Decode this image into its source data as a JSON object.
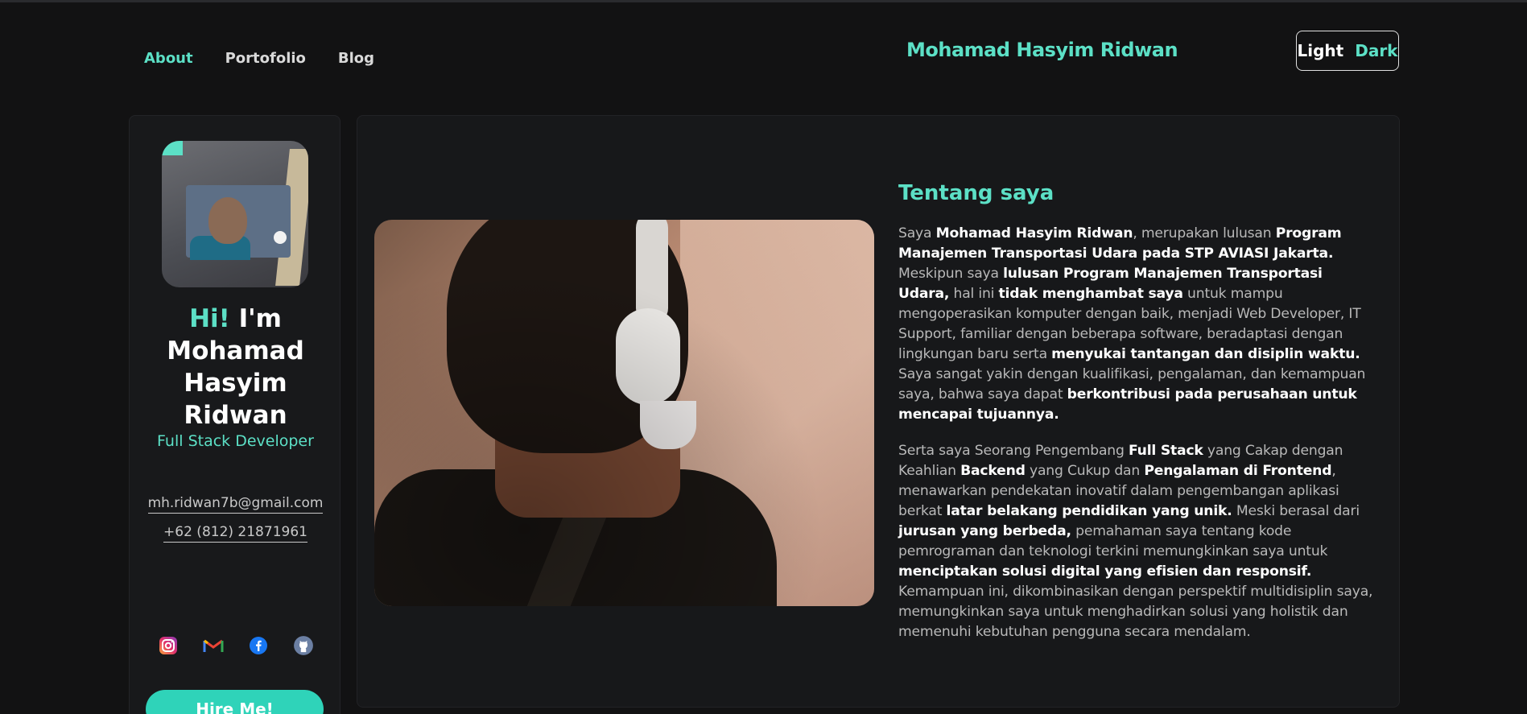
{
  "nav": {
    "items": [
      "About",
      "Portofolio",
      "Blog"
    ],
    "active": "About"
  },
  "brand": "Mohamad Hasyim Ridwan",
  "theme": {
    "light": "Light",
    "dark": "Dark"
  },
  "profile": {
    "hi": "Hi!",
    "im": "I'm",
    "name_lines": [
      "Mohamad",
      "Hasyim",
      "Ridwan"
    ],
    "role": "Full Stack Developer",
    "email": "mh.ridwan7b@gmail.com",
    "phone": "+62 (812) 21871961",
    "socials": [
      "instagram-icon",
      "gmail-icon",
      "facebook-icon",
      "github-icon"
    ],
    "hire_label": "Hire Me!"
  },
  "about": {
    "title": "Tentang saya",
    "p1": [
      {
        "t": "Saya ",
        "b": false
      },
      {
        "t": "Mohamad Hasyim Ridwan",
        "b": true
      },
      {
        "t": ", merupakan lulusan ",
        "b": false
      },
      {
        "t": "Program Manajemen Transportasi Udara pada STP AVIASI Jakarta.",
        "b": true
      },
      {
        "t": " Meskipun saya ",
        "b": false
      },
      {
        "t": "lulusan Program Manajemen Transportasi Udara,",
        "b": true
      },
      {
        "t": " hal ini ",
        "b": false
      },
      {
        "t": "tidak menghambat saya",
        "b": true
      },
      {
        "t": " untuk mampu mengoperasikan komputer dengan baik, menjadi Web Developer, IT Support, familiar dengan beberapa software, beradaptasi dengan lingkungan baru serta ",
        "b": false
      },
      {
        "t": "menyukai tantangan dan disiplin waktu.",
        "b": true
      },
      {
        "t": " Saya sangat yakin dengan kualifikasi, pengalaman, dan kemampuan saya, bahwa saya dapat ",
        "b": false
      },
      {
        "t": "berkontribusi pada perusahaan untuk mencapai tujuannya.",
        "b": true
      }
    ],
    "p2": [
      {
        "t": "Serta saya Seorang Pengembang ",
        "b": false
      },
      {
        "t": "Full Stack",
        "b": true
      },
      {
        "t": " yang Cakap dengan Keahlian ",
        "b": false
      },
      {
        "t": "Backend",
        "b": true
      },
      {
        "t": " yang Cukup dan ",
        "b": false
      },
      {
        "t": "Pengalaman di Frontend",
        "b": true
      },
      {
        "t": ", menawarkan pendekatan inovatif dalam pengembangan aplikasi berkat ",
        "b": false
      },
      {
        "t": "latar belakang pendidikan yang unik.",
        "b": true
      },
      {
        "t": " Meski berasal dari ",
        "b": false
      },
      {
        "t": "jurusan yang berbeda,",
        "b": true
      },
      {
        "t": " pemahaman saya tentang kode pemrograman dan teknologi terkini memungkinkan saya untuk ",
        "b": false
      },
      {
        "t": "menciptakan solusi digital yang efisien dan responsif.",
        "b": true
      },
      {
        "t": " Kemampuan ini, dikombinasikan dengan perspektif multidisiplin saya, memungkinkan saya untuk menghadirkan solusi yang holistik dan memenuhi kebutuhan pengguna secara mendalam.",
        "b": false
      }
    ]
  },
  "colors": {
    "accent": "#5ce0c6",
    "button": "#2fd3b9",
    "background": "#121213",
    "card": "#18191b"
  }
}
